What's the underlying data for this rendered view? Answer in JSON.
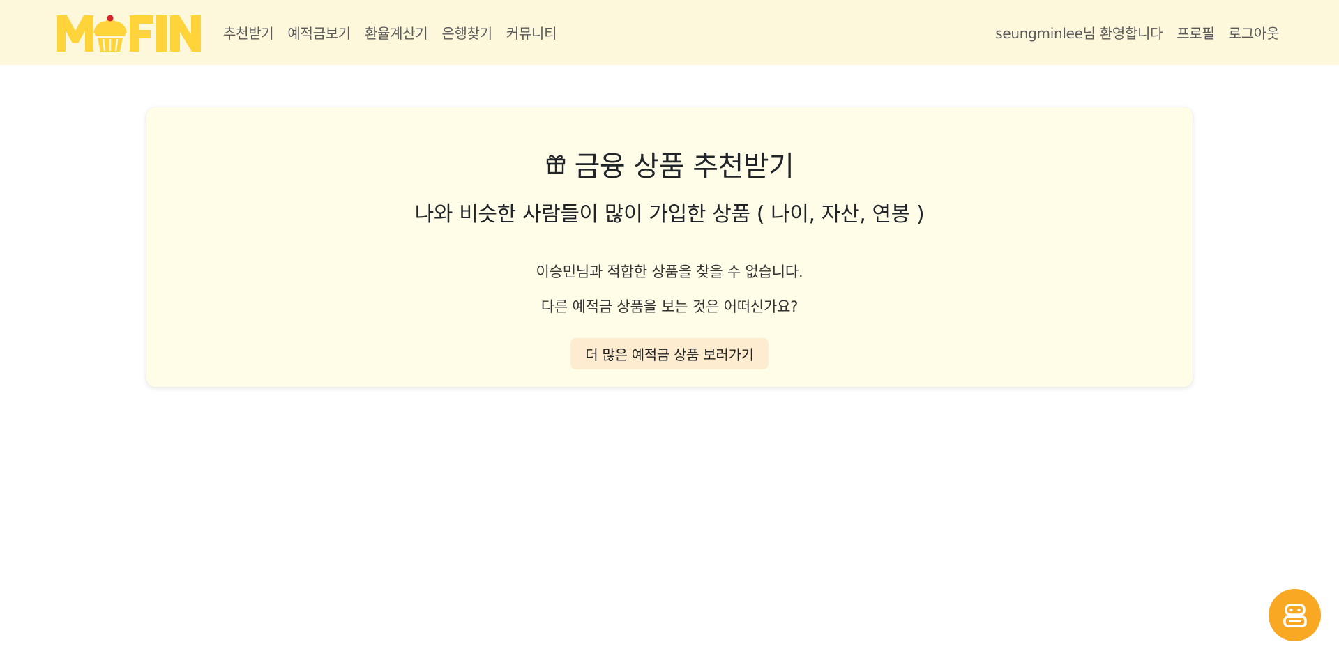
{
  "brand": {
    "logo_text": "MFIN",
    "logo_color": "#ffd43b"
  },
  "nav": {
    "left_items": [
      {
        "label": "추천받기"
      },
      {
        "label": "예적금보기"
      },
      {
        "label": "환율계산기"
      },
      {
        "label": "은행찾기"
      },
      {
        "label": "커뮤니티"
      }
    ],
    "welcome": "seungminlee님 환영합니다",
    "profile": "프로필",
    "logout": "로그아웃"
  },
  "card": {
    "icon": "gift-icon",
    "title": "금융 상품 추천받기",
    "subtitle": "나와 비슷한 사람들이 많이 가입한 상품 ( 나이, 자산, 연봉 )",
    "message_1": "이승민님과 적합한 상품을 찾을 수 없습니다.",
    "message_2": "다른 예적금 상품을 보는 것은 어떠신가요?",
    "button_label": "더 많은 예적금 상품 보러가기"
  },
  "chatbot": {
    "icon": "robot-icon",
    "color": "#f9a824"
  },
  "colors": {
    "navbar_bg": "#fdf7dc",
    "card_bg": "#fffde7",
    "button_bg": "#fdecd0"
  }
}
